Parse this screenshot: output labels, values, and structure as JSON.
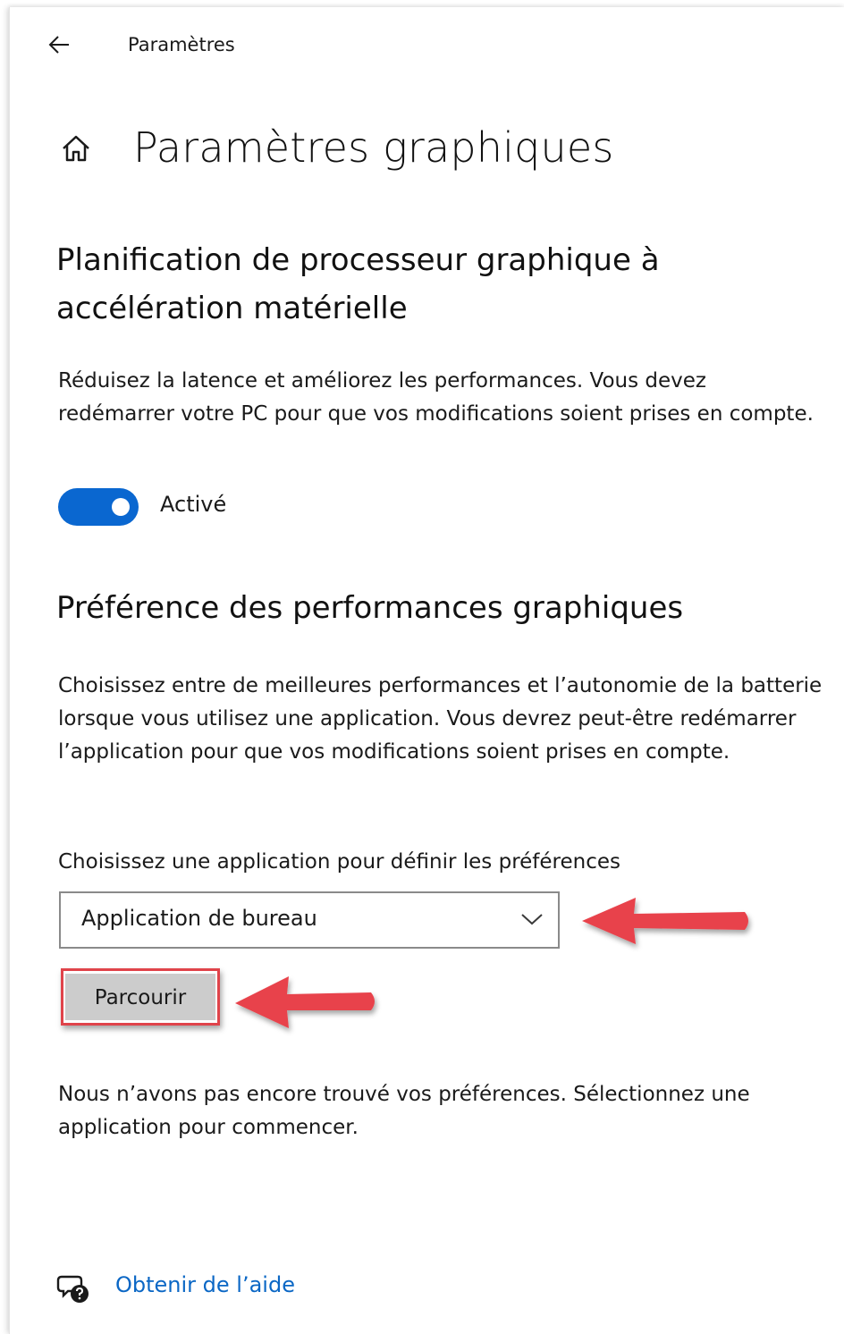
{
  "header": {
    "back_icon": "arrow-left-icon",
    "app_title": "Paramètres"
  },
  "page": {
    "home_icon": "home-icon",
    "title": "Paramètres graphiques"
  },
  "gpu_scheduling": {
    "heading": "Planification de processeur graphique à accélération matérielle",
    "description": "Réduisez la latence et améliorez les performances. Vous devez redémarrer votre PC pour que vos modifications soient prises en compte.",
    "toggle_state": "on",
    "toggle_label": "Activé"
  },
  "performance_preference": {
    "heading": "Préférence des performances graphiques",
    "description": "Choisissez entre de meilleures performances et l’autonomie de la batterie lorsque vous utilisez une application. Vous devrez peut-être redémarrer l’application pour que vos modifications soient prises en compte.",
    "select_label": "Choisissez une application pour définir les préférences",
    "dropdown_value": "Application de bureau",
    "browse_label": "Parcourir",
    "empty_message": "Nous n’avons pas encore trouvé vos préférences. Sélectionnez une application pour commencer."
  },
  "help": {
    "icon": "help-chat-icon",
    "link_label": "Obtenir de l’aide"
  },
  "colors": {
    "accent": "#0a67d0",
    "link": "#0b67c5",
    "annotation_red": "#e0434a"
  }
}
